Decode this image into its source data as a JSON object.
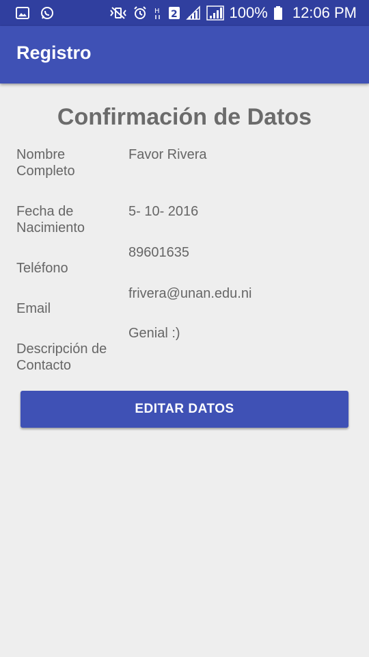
{
  "status_bar": {
    "battery_text": "100%",
    "clock": "12:06 PM",
    "icons": [
      "gallery-icon",
      "whatsapp-icon",
      "vibrate-icon",
      "alarm-icon",
      "hspa-icon",
      "sim2-icon",
      "signal-icon",
      "signal-icon",
      "battery-icon"
    ]
  },
  "app_bar": {
    "title": "Registro",
    "color": "#3f51b5"
  },
  "main": {
    "heading": "Confirmación de Datos",
    "fields": [
      {
        "label": "Nombre Completo",
        "value": "Favor Rivera"
      },
      {
        "label": "Fecha de Nacimiento",
        "value": "5- 10- 2016"
      },
      {
        "label": "Teléfono",
        "value": "89601635"
      },
      {
        "label": "Email",
        "value": "frivera@unan.edu.ni"
      },
      {
        "label": "Descripción de Contacto",
        "value": "Genial :)"
      }
    ],
    "edit_button_label": "EDITAR DATOS"
  }
}
